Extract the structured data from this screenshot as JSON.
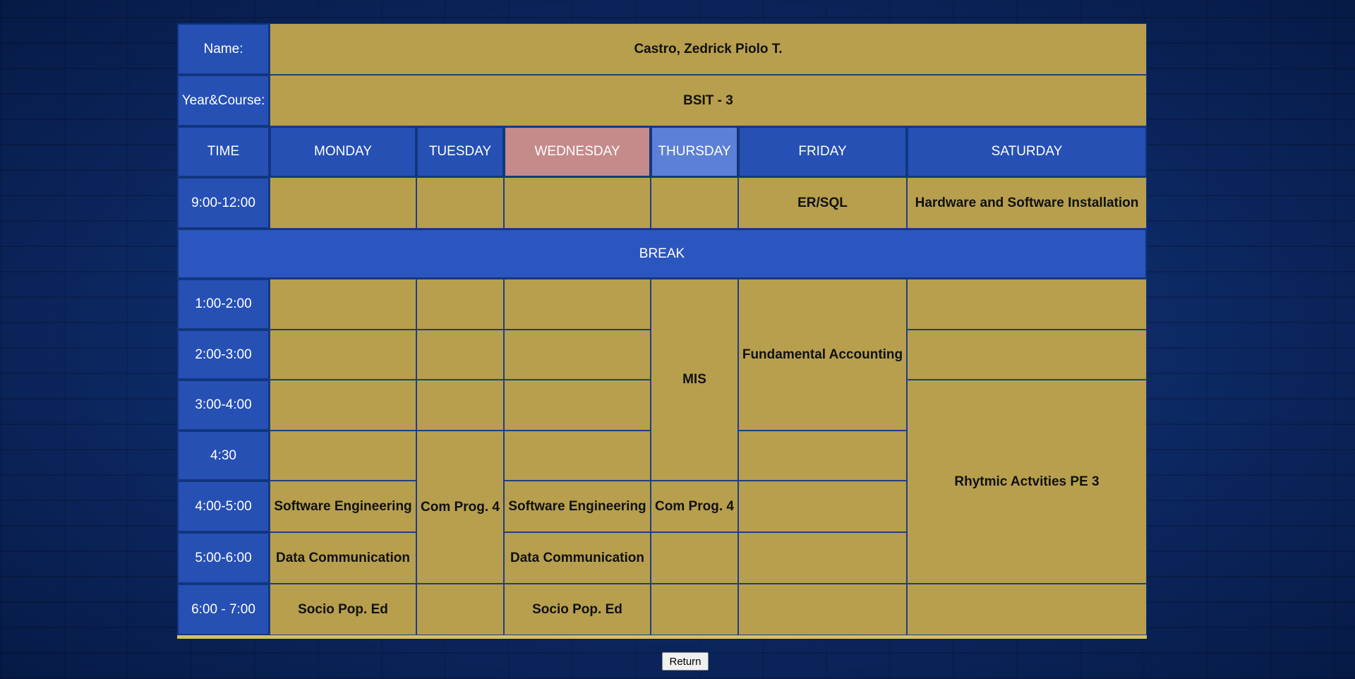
{
  "student": {
    "name_label": "Name:",
    "name_value": "Castro, Zedrick Piolo T.",
    "course_label": "Year&Course:",
    "course_value": "BSIT - 3"
  },
  "headers": {
    "time": "TIME",
    "monday": "MONDAY",
    "tuesday": "TUESDAY",
    "wednesday": "WEDNESDAY",
    "thursday": "THURSDAY",
    "friday": "FRIDAY",
    "saturday": "SATURDAY"
  },
  "times": [
    "9:00-12:00",
    "1:00-2:00",
    "2:00-3:00",
    "3:00-4:00",
    "4:30",
    "4:00-5:00",
    "5:00-6:00",
    "6:00 - 7:00"
  ],
  "break_label": "BREAK",
  "classes": {
    "friday_morning": "ER/SQL",
    "saturday_morning": "Hardware and Software Installation",
    "thursday_mis": "MIS",
    "friday_accounting": "Fundamental Accounting",
    "saturday_pe": "Rhytmic Actvities PE 3",
    "monday_se": "Software Engineering",
    "tuesday_comprog": "Com Prog. 4",
    "wednesday_se": "Software Engineering",
    "thursday_comprog": "Com Prog. 4",
    "monday_datacom": "Data Communication",
    "wednesday_datacom": "Data Communication",
    "monday_socio": "Socio Pop. Ed",
    "wednesday_socio": "Socio Pop. Ed"
  },
  "return_label": "Return",
  "colors": {
    "header_blue": "#2650b4",
    "cell_gold": "#af9646",
    "wednesday_pink": "#c58a8a",
    "background": "#0b2a66"
  }
}
